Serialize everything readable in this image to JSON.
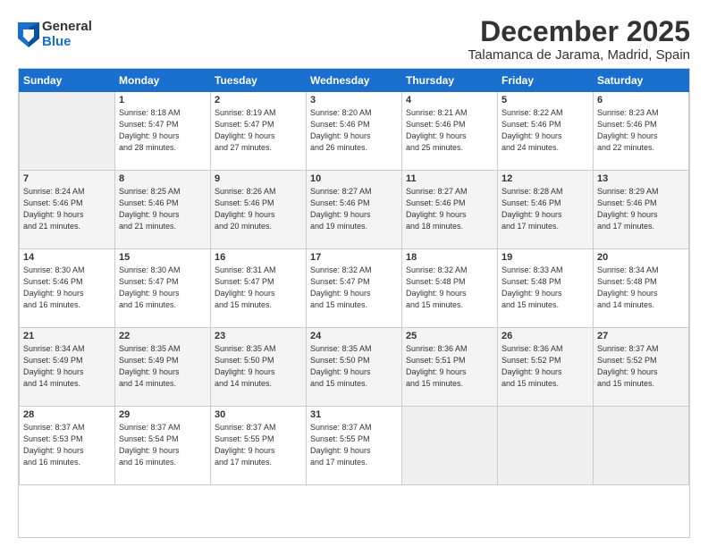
{
  "logo": {
    "general": "General",
    "blue": "Blue"
  },
  "title": {
    "month": "December 2025",
    "location": "Talamanca de Jarama, Madrid, Spain"
  },
  "days_header": [
    "Sunday",
    "Monday",
    "Tuesday",
    "Wednesday",
    "Thursday",
    "Friday",
    "Saturday"
  ],
  "weeks": [
    [
      {
        "day": "",
        "info": ""
      },
      {
        "day": "1",
        "info": "Sunrise: 8:18 AM\nSunset: 5:47 PM\nDaylight: 9 hours\nand 28 minutes."
      },
      {
        "day": "2",
        "info": "Sunrise: 8:19 AM\nSunset: 5:47 PM\nDaylight: 9 hours\nand 27 minutes."
      },
      {
        "day": "3",
        "info": "Sunrise: 8:20 AM\nSunset: 5:46 PM\nDaylight: 9 hours\nand 26 minutes."
      },
      {
        "day": "4",
        "info": "Sunrise: 8:21 AM\nSunset: 5:46 PM\nDaylight: 9 hours\nand 25 minutes."
      },
      {
        "day": "5",
        "info": "Sunrise: 8:22 AM\nSunset: 5:46 PM\nDaylight: 9 hours\nand 24 minutes."
      },
      {
        "day": "6",
        "info": "Sunrise: 8:23 AM\nSunset: 5:46 PM\nDaylight: 9 hours\nand 22 minutes."
      }
    ],
    [
      {
        "day": "7",
        "info": "Sunrise: 8:24 AM\nSunset: 5:46 PM\nDaylight: 9 hours\nand 21 minutes."
      },
      {
        "day": "8",
        "info": "Sunrise: 8:25 AM\nSunset: 5:46 PM\nDaylight: 9 hours\nand 21 minutes."
      },
      {
        "day": "9",
        "info": "Sunrise: 8:26 AM\nSunset: 5:46 PM\nDaylight: 9 hours\nand 20 minutes."
      },
      {
        "day": "10",
        "info": "Sunrise: 8:27 AM\nSunset: 5:46 PM\nDaylight: 9 hours\nand 19 minutes."
      },
      {
        "day": "11",
        "info": "Sunrise: 8:27 AM\nSunset: 5:46 PM\nDaylight: 9 hours\nand 18 minutes."
      },
      {
        "day": "12",
        "info": "Sunrise: 8:28 AM\nSunset: 5:46 PM\nDaylight: 9 hours\nand 17 minutes."
      },
      {
        "day": "13",
        "info": "Sunrise: 8:29 AM\nSunset: 5:46 PM\nDaylight: 9 hours\nand 17 minutes."
      }
    ],
    [
      {
        "day": "14",
        "info": "Sunrise: 8:30 AM\nSunset: 5:46 PM\nDaylight: 9 hours\nand 16 minutes."
      },
      {
        "day": "15",
        "info": "Sunrise: 8:30 AM\nSunset: 5:47 PM\nDaylight: 9 hours\nand 16 minutes."
      },
      {
        "day": "16",
        "info": "Sunrise: 8:31 AM\nSunset: 5:47 PM\nDaylight: 9 hours\nand 15 minutes."
      },
      {
        "day": "17",
        "info": "Sunrise: 8:32 AM\nSunset: 5:47 PM\nDaylight: 9 hours\nand 15 minutes."
      },
      {
        "day": "18",
        "info": "Sunrise: 8:32 AM\nSunset: 5:48 PM\nDaylight: 9 hours\nand 15 minutes."
      },
      {
        "day": "19",
        "info": "Sunrise: 8:33 AM\nSunset: 5:48 PM\nDaylight: 9 hours\nand 15 minutes."
      },
      {
        "day": "20",
        "info": "Sunrise: 8:34 AM\nSunset: 5:48 PM\nDaylight: 9 hours\nand 14 minutes."
      }
    ],
    [
      {
        "day": "21",
        "info": "Sunrise: 8:34 AM\nSunset: 5:49 PM\nDaylight: 9 hours\nand 14 minutes."
      },
      {
        "day": "22",
        "info": "Sunrise: 8:35 AM\nSunset: 5:49 PM\nDaylight: 9 hours\nand 14 minutes."
      },
      {
        "day": "23",
        "info": "Sunrise: 8:35 AM\nSunset: 5:50 PM\nDaylight: 9 hours\nand 14 minutes."
      },
      {
        "day": "24",
        "info": "Sunrise: 8:35 AM\nSunset: 5:50 PM\nDaylight: 9 hours\nand 15 minutes."
      },
      {
        "day": "25",
        "info": "Sunrise: 8:36 AM\nSunset: 5:51 PM\nDaylight: 9 hours\nand 15 minutes."
      },
      {
        "day": "26",
        "info": "Sunrise: 8:36 AM\nSunset: 5:52 PM\nDaylight: 9 hours\nand 15 minutes."
      },
      {
        "day": "27",
        "info": "Sunrise: 8:37 AM\nSunset: 5:52 PM\nDaylight: 9 hours\nand 15 minutes."
      }
    ],
    [
      {
        "day": "28",
        "info": "Sunrise: 8:37 AM\nSunset: 5:53 PM\nDaylight: 9 hours\nand 16 minutes."
      },
      {
        "day": "29",
        "info": "Sunrise: 8:37 AM\nSunset: 5:54 PM\nDaylight: 9 hours\nand 16 minutes."
      },
      {
        "day": "30",
        "info": "Sunrise: 8:37 AM\nSunset: 5:55 PM\nDaylight: 9 hours\nand 17 minutes."
      },
      {
        "day": "31",
        "info": "Sunrise: 8:37 AM\nSunset: 5:55 PM\nDaylight: 9 hours\nand 17 minutes."
      },
      {
        "day": "",
        "info": ""
      },
      {
        "day": "",
        "info": ""
      },
      {
        "day": "",
        "info": ""
      }
    ]
  ]
}
